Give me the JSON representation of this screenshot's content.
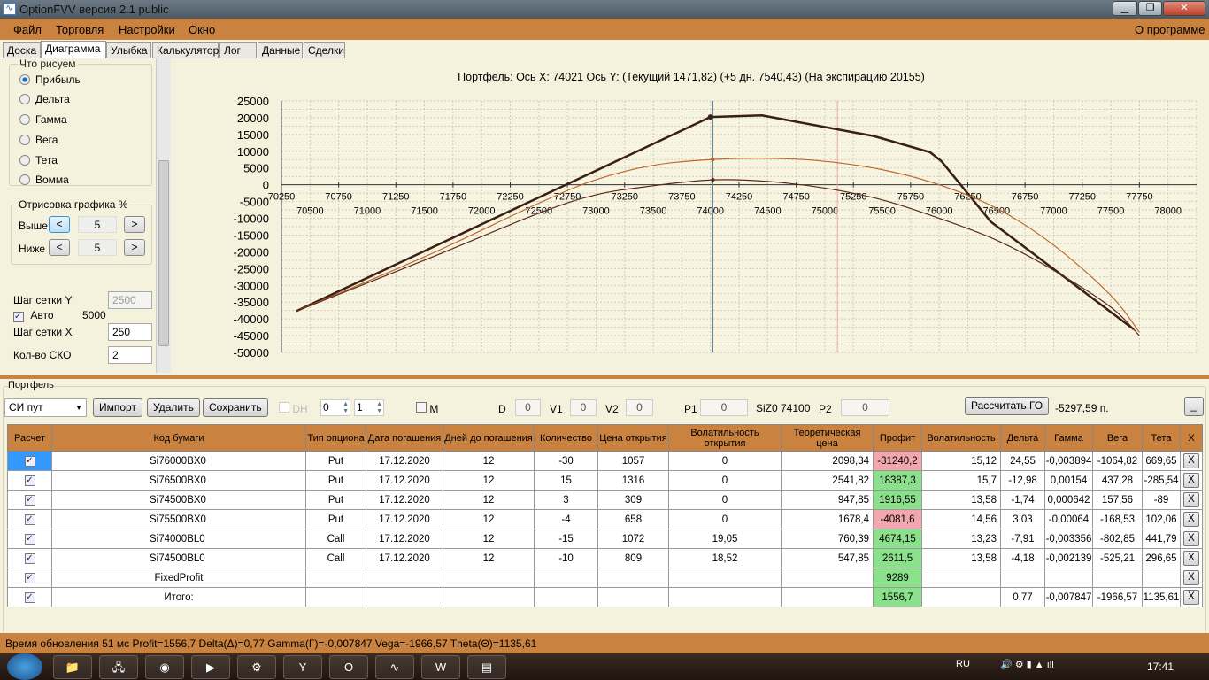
{
  "window": {
    "title": "OptionFVV версия 2.1 public",
    "min": "▁",
    "max": "❐",
    "close": "✕"
  },
  "menu": {
    "items": [
      "Файл",
      "Торговля",
      "Настройки",
      "Окно"
    ],
    "about": "О программе"
  },
  "tabs": [
    "Доска",
    "Диаграмма",
    "Улыбка",
    "Калькулятор",
    "Лог",
    "Данные",
    "Сделки"
  ],
  "active_tab": "Диаграмма",
  "left": {
    "group_title": "Что рисуем",
    "radios": [
      "Прибыль",
      "Дельта",
      "Гамма",
      "Вега",
      "Тета",
      "Вомма"
    ],
    "selected": "Прибыль",
    "draw_group": "Отрисовка графика %",
    "above_label": "Выше",
    "above_value": "5",
    "below_label": "Ниже",
    "below_value": "5",
    "prev": "<",
    "next": ">",
    "grid_y_label": "Шаг сетки Y",
    "grid_y_value": "2500",
    "auto_label": "Авто",
    "auto_checked": true,
    "auto_value": "5000",
    "grid_x_label": "Шаг сетки X",
    "grid_x_value": "250",
    "sko_label": "Кол-во СКО",
    "sko_value": "2"
  },
  "chart_data": {
    "type": "line",
    "title": "Портфель:  Ось X:  74021  Ось Y:   (Текущий 1471,82)   (+5 дн. 7540,43)   (На экспирацию 20155)",
    "xlim": [
      70250,
      78250
    ],
    "ylim": [
      -50000,
      25000
    ],
    "grid": true,
    "x_ticks_upper": [
      "70250",
      "70750",
      "71250",
      "71750",
      "72250",
      "72750",
      "73250",
      "73750",
      "74250",
      "74750",
      "75250",
      "75750",
      "76250",
      "76750",
      "77250",
      "77750"
    ],
    "x_ticks_lower": [
      "70500",
      "71000",
      "71500",
      "72000",
      "72500",
      "73000",
      "73500",
      "74000",
      "74500",
      "75000",
      "75500",
      "76000",
      "76500",
      "77000",
      "77500",
      "78000"
    ],
    "y_ticks": [
      "25000",
      "20000",
      "15000",
      "10000",
      "5000",
      "0",
      "-5000",
      "-10000",
      "-15000",
      "-20000",
      "-25000",
      "-30000",
      "-35000",
      "-40000",
      "-45000",
      "-50000"
    ],
    "vlines": [
      {
        "x": 74021,
        "color": "#4a7a96"
      },
      {
        "x": 75110,
        "color": "#f4a0a8"
      }
    ],
    "series": [
      {
        "color": "#3a1f12",
        "width": 2.5,
        "x": [
          70380,
          74000,
          74450,
          75430,
          75920,
          76020,
          76450,
          77700
        ],
        "y": [
          -37700,
          20200,
          20700,
          14500,
          9700,
          7000,
          -11000,
          -43100
        ],
        "marker": {
          "x": 74000,
          "y": 20200
        }
      },
      {
        "color": "#c0662e",
        "width": 1.2,
        "x": [
          70380,
          71500,
          72500,
          73000,
          73500,
          74021,
          74500,
          75000,
          75500,
          76000,
          76500,
          77000,
          77500,
          77750
        ],
        "y": [
          -37700,
          -21500,
          -5500,
          1500,
          5800,
          7540,
          7900,
          7000,
          4500,
          0,
          -7000,
          -18000,
          -33000,
          -44000
        ],
        "marker": {
          "x": 74021,
          "y": 7540
        }
      },
      {
        "color": "#5a2a18",
        "width": 1.2,
        "x": [
          70380,
          71500,
          72500,
          73000,
          73500,
          74021,
          74500,
          75000,
          75500,
          76000,
          76500,
          77000,
          77500,
          77750
        ],
        "y": [
          -37700,
          -22500,
          -8500,
          -3000,
          -300,
          1472,
          1000,
          -1000,
          -4500,
          -10000,
          -16500,
          -25500,
          -36500,
          -45000
        ],
        "marker": {
          "x": 74021,
          "y": 1472
        }
      }
    ]
  },
  "portfolio": {
    "title": "Портфель",
    "select": "СИ пут",
    "import": "Импорт",
    "delete": "Удалить",
    "save": "Сохранить",
    "dh": "DH",
    "spin1": "0",
    "spin2": "1",
    "m": "M",
    "d_label": "D",
    "d": "0",
    "v1_label": "V1",
    "v1": "0",
    "v2_label": "V2",
    "v2": "0",
    "p1_label": "P1",
    "p1": "0",
    "siz": "SiZ0 74100",
    "p2_label": "P2",
    "p2": "0",
    "calc_go": "Рассчитать ГО",
    "go_value": "-5297,59 п.",
    "collapse": "_"
  },
  "table": {
    "headers": [
      "Расчет",
      "Код бумаги",
      "Тип опциона",
      "Дата погашения",
      "Дней до погашения",
      "Количество",
      "Цена открытия",
      "Волатильность открытия",
      "Теоретическая цена",
      "Профит",
      "Волатильность",
      "Дельта",
      "Гамма",
      "Вега",
      "Тета",
      "X"
    ],
    "rows": [
      [
        "Si76000BX0",
        "Put",
        "17.12.2020",
        "12",
        "-30",
        "1057",
        "0",
        "2098,34",
        "-31240,2",
        "15,12",
        "24,55",
        "-0,003894",
        "-1064,82",
        "669,65"
      ],
      [
        "Si76500BX0",
        "Put",
        "17.12.2020",
        "12",
        "15",
        "1316",
        "0",
        "2541,82",
        "18387,3",
        "15,7",
        "-12,98",
        "0,00154",
        "437,28",
        "-285,54"
      ],
      [
        "Si74500BX0",
        "Put",
        "17.12.2020",
        "12",
        "3",
        "309",
        "0",
        "947,85",
        "1916,55",
        "13,58",
        "-1,74",
        "0,000642",
        "157,56",
        "-89"
      ],
      [
        "Si75500BX0",
        "Put",
        "17.12.2020",
        "12",
        "-4",
        "658",
        "0",
        "1678,4",
        "-4081,6",
        "14,56",
        "3,03",
        "-0,00064",
        "-168,53",
        "102,06"
      ],
      [
        "Si74000BL0",
        "Call",
        "17.12.2020",
        "12",
        "-15",
        "1072",
        "19,05",
        "760,39",
        "4674,15",
        "13,23",
        "-7,91",
        "-0,003356",
        "-802,85",
        "441,79"
      ],
      [
        "Si74500BL0",
        "Call",
        "17.12.2020",
        "12",
        "-10",
        "809",
        "18,52",
        "547,85",
        "2611,5",
        "13,58",
        "-4,18",
        "-0,002139",
        "-525,21",
        "296,65"
      ],
      [
        "FixedProfit",
        "",
        "",
        "",
        "",
        "",
        "",
        "",
        "9289",
        "",
        "",
        "",
        "",
        ""
      ],
      [
        "Итого:",
        "",
        "",
        "",
        "",
        "",
        "",
        "",
        "1556,7",
        "",
        "0,77",
        "-0,007847",
        "-1966,57",
        "1135,61"
      ]
    ],
    "checked": "✓",
    "remove": "X"
  },
  "status": "Время обновления 51 мс  Profit=1556,7 Delta(Δ)=0,77 Gamma(Γ)=-0,007847 Vega=-1966,57 Theta(Θ)=1135,61",
  "taskbar": {
    "apps": [
      "explorer-icon",
      "network-icon",
      "chrome-icon",
      "media-player-icon",
      "settings-icon",
      "yandex-icon",
      "opera-icon",
      "optionfvv-icon",
      "word-icon",
      "notes-icon"
    ],
    "lang": "RU",
    "time": "17:41"
  }
}
